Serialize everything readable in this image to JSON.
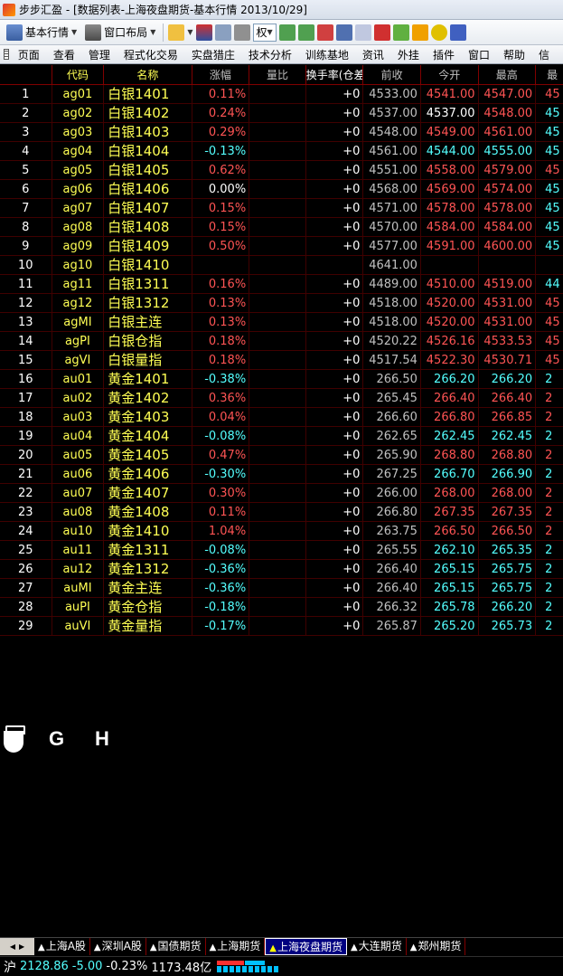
{
  "window": {
    "title": "步步汇盈 - [数据列表-上海夜盘期货-基本行情 2013/10/29]"
  },
  "toolbar": {
    "basic_quote": "基本行情",
    "window_layout": "窗口布局",
    "quan_label": "权"
  },
  "menu": [
    "页面",
    "查看",
    "管理",
    "程式化交易",
    "实盘猎庄",
    "技术分析",
    "训练基地",
    "资讯",
    "外挂",
    "插件",
    "窗口",
    "帮助",
    "信"
  ],
  "columns": {
    "idx": "",
    "code": "代码",
    "name": "名称",
    "chg": "涨幅",
    "ratio": "量比",
    "turnover": "换手率(仓差",
    "prev": "前收",
    "open": "今开",
    "high": "最高",
    "last": "最"
  },
  "rows": [
    {
      "idx": "1",
      "code": "ag01",
      "name": "白银1401",
      "chg": "0.11%",
      "dir": "up",
      "turn": "+0",
      "prev": "4533.00",
      "open": "4541.00",
      "open_dir": "up",
      "high": "4547.00",
      "high_dir": "up",
      "last": "45",
      "last_dir": "up"
    },
    {
      "idx": "2",
      "code": "ag02",
      "name": "白银1402",
      "chg": "0.24%",
      "dir": "up",
      "turn": "+0",
      "prev": "4537.00",
      "open": "4537.00",
      "open_dir": "eq",
      "high": "4548.00",
      "high_dir": "up",
      "last": "45",
      "last_dir": "dn"
    },
    {
      "idx": "3",
      "code": "ag03",
      "name": "白银1403",
      "chg": "0.29%",
      "dir": "up",
      "turn": "+0",
      "prev": "4548.00",
      "open": "4549.00",
      "open_dir": "up",
      "high": "4561.00",
      "high_dir": "up",
      "last": "45",
      "last_dir": "dn"
    },
    {
      "idx": "4",
      "code": "ag04",
      "name": "白银1404",
      "chg": "-0.13%",
      "dir": "dn",
      "turn": "+0",
      "prev": "4561.00",
      "open": "4544.00",
      "open_dir": "dn",
      "high": "4555.00",
      "high_dir": "dn",
      "last": "45",
      "last_dir": "dn"
    },
    {
      "idx": "5",
      "code": "ag05",
      "name": "白银1405",
      "chg": "0.62%",
      "dir": "up",
      "turn": "+0",
      "prev": "4551.00",
      "open": "4558.00",
      "open_dir": "up",
      "high": "4579.00",
      "high_dir": "up",
      "last": "45",
      "last_dir": "up"
    },
    {
      "idx": "6",
      "code": "ag06",
      "name": "白银1406",
      "chg": "0.00%",
      "dir": "eq",
      "turn": "+0",
      "prev": "4568.00",
      "open": "4569.00",
      "open_dir": "up",
      "high": "4574.00",
      "high_dir": "up",
      "last": "45",
      "last_dir": "dn"
    },
    {
      "idx": "7",
      "code": "ag07",
      "name": "白银1407",
      "chg": "0.15%",
      "dir": "up",
      "turn": "+0",
      "prev": "4571.00",
      "open": "4578.00",
      "open_dir": "up",
      "high": "4578.00",
      "high_dir": "up",
      "last": "45",
      "last_dir": "dn"
    },
    {
      "idx": "8",
      "code": "ag08",
      "name": "白银1408",
      "chg": "0.15%",
      "dir": "up",
      "turn": "+0",
      "prev": "4570.00",
      "open": "4584.00",
      "open_dir": "up",
      "high": "4584.00",
      "high_dir": "up",
      "last": "45",
      "last_dir": "dn"
    },
    {
      "idx": "9",
      "code": "ag09",
      "name": "白银1409",
      "chg": "0.50%",
      "dir": "up",
      "turn": "+0",
      "prev": "4577.00",
      "open": "4591.00",
      "open_dir": "up",
      "high": "4600.00",
      "high_dir": "up",
      "last": "45",
      "last_dir": "dn"
    },
    {
      "idx": "10",
      "code": "ag10",
      "name": "白银1410",
      "chg": "",
      "dir": "eq",
      "turn": "",
      "prev": "4641.00",
      "open": "",
      "open_dir": "eq",
      "high": "",
      "high_dir": "eq",
      "last": "",
      "last_dir": "eq"
    },
    {
      "idx": "11",
      "code": "ag11",
      "name": "白银1311",
      "chg": "0.16%",
      "dir": "up",
      "turn": "+0",
      "prev": "4489.00",
      "open": "4510.00",
      "open_dir": "up",
      "high": "4519.00",
      "high_dir": "up",
      "last": "44",
      "last_dir": "dn"
    },
    {
      "idx": "12",
      "code": "ag12",
      "name": "白银1312",
      "chg": "0.13%",
      "dir": "up",
      "turn": "+0",
      "prev": "4518.00",
      "open": "4520.00",
      "open_dir": "up",
      "high": "4531.00",
      "high_dir": "up",
      "last": "45",
      "last_dir": "up"
    },
    {
      "idx": "13",
      "code": "agMI",
      "name": "白银主连",
      "chg": "0.13%",
      "dir": "up",
      "turn": "+0",
      "prev": "4518.00",
      "open": "4520.00",
      "open_dir": "up",
      "high": "4531.00",
      "high_dir": "up",
      "last": "45",
      "last_dir": "up"
    },
    {
      "idx": "14",
      "code": "agPI",
      "name": "白银仓指",
      "chg": "0.18%",
      "dir": "up",
      "turn": "+0",
      "prev": "4520.22",
      "open": "4526.16",
      "open_dir": "up",
      "high": "4533.53",
      "high_dir": "up",
      "last": "45",
      "last_dir": "up"
    },
    {
      "idx": "15",
      "code": "agVI",
      "name": "白银量指",
      "chg": "0.18%",
      "dir": "up",
      "turn": "+0",
      "prev": "4517.54",
      "open": "4522.30",
      "open_dir": "up",
      "high": "4530.71",
      "high_dir": "up",
      "last": "45",
      "last_dir": "up"
    },
    {
      "idx": "16",
      "code": "au01",
      "name": "黄金1401",
      "chg": "-0.38%",
      "dir": "dn",
      "turn": "+0",
      "prev": "266.50",
      "open": "266.20",
      "open_dir": "dn",
      "high": "266.20",
      "high_dir": "dn",
      "last": "2",
      "last_dir": "dn"
    },
    {
      "idx": "17",
      "code": "au02",
      "name": "黄金1402",
      "chg": "0.36%",
      "dir": "up",
      "turn": "+0",
      "prev": "265.45",
      "open": "266.40",
      "open_dir": "up",
      "high": "266.40",
      "high_dir": "up",
      "last": "2",
      "last_dir": "up"
    },
    {
      "idx": "18",
      "code": "au03",
      "name": "黄金1403",
      "chg": "0.04%",
      "dir": "up",
      "turn": "+0",
      "prev": "266.60",
      "open": "266.80",
      "open_dir": "up",
      "high": "266.85",
      "high_dir": "up",
      "last": "2",
      "last_dir": "up"
    },
    {
      "idx": "19",
      "code": "au04",
      "name": "黄金1404",
      "chg": "-0.08%",
      "dir": "dn",
      "turn": "+0",
      "prev": "262.65",
      "open": "262.45",
      "open_dir": "dn",
      "high": "262.45",
      "high_dir": "dn",
      "last": "2",
      "last_dir": "dn"
    },
    {
      "idx": "20",
      "code": "au05",
      "name": "黄金1405",
      "chg": "0.47%",
      "dir": "up",
      "turn": "+0",
      "prev": "265.90",
      "open": "268.80",
      "open_dir": "up",
      "high": "268.80",
      "high_dir": "up",
      "last": "2",
      "last_dir": "up"
    },
    {
      "idx": "21",
      "code": "au06",
      "name": "黄金1406",
      "chg": "-0.30%",
      "dir": "dn",
      "turn": "+0",
      "prev": "267.25",
      "open": "266.70",
      "open_dir": "dn",
      "high": "266.90",
      "high_dir": "dn",
      "last": "2",
      "last_dir": "dn"
    },
    {
      "idx": "22",
      "code": "au07",
      "name": "黄金1407",
      "chg": "0.30%",
      "dir": "up",
      "turn": "+0",
      "prev": "266.00",
      "open": "268.00",
      "open_dir": "up",
      "high": "268.00",
      "high_dir": "up",
      "last": "2",
      "last_dir": "up"
    },
    {
      "idx": "23",
      "code": "au08",
      "name": "黄金1408",
      "chg": "0.11%",
      "dir": "up",
      "turn": "+0",
      "prev": "266.80",
      "open": "267.35",
      "open_dir": "up",
      "high": "267.35",
      "high_dir": "up",
      "last": "2",
      "last_dir": "up"
    },
    {
      "idx": "24",
      "code": "au10",
      "name": "黄金1410",
      "chg": "1.04%",
      "dir": "up",
      "turn": "+0",
      "prev": "263.75",
      "open": "266.50",
      "open_dir": "up",
      "high": "266.50",
      "high_dir": "up",
      "last": "2",
      "last_dir": "up"
    },
    {
      "idx": "25",
      "code": "au11",
      "name": "黄金1311",
      "chg": "-0.08%",
      "dir": "dn",
      "turn": "+0",
      "prev": "265.55",
      "open": "262.10",
      "open_dir": "dn",
      "high": "265.35",
      "high_dir": "dn",
      "last": "2",
      "last_dir": "dn"
    },
    {
      "idx": "26",
      "code": "au12",
      "name": "黄金1312",
      "chg": "-0.36%",
      "dir": "dn",
      "turn": "+0",
      "prev": "266.40",
      "open": "265.15",
      "open_dir": "dn",
      "high": "265.75",
      "high_dir": "dn",
      "last": "2",
      "last_dir": "dn"
    },
    {
      "idx": "27",
      "code": "auMI",
      "name": "黄金主连",
      "chg": "-0.36%",
      "dir": "dn",
      "turn": "+0",
      "prev": "266.40",
      "open": "265.15",
      "open_dir": "dn",
      "high": "265.75",
      "high_dir": "dn",
      "last": "2",
      "last_dir": "dn"
    },
    {
      "idx": "28",
      "code": "auPI",
      "name": "黄金仓指",
      "chg": "-0.18%",
      "dir": "dn",
      "turn": "+0",
      "prev": "266.32",
      "open": "265.78",
      "open_dir": "dn",
      "high": "266.20",
      "high_dir": "dn",
      "last": "2",
      "last_dir": "dn"
    },
    {
      "idx": "29",
      "code": "auVI",
      "name": "黄金量指",
      "chg": "-0.17%",
      "dir": "dn",
      "turn": "+0",
      "prev": "265.87",
      "open": "265.20",
      "open_dir": "dn",
      "high": "265.73",
      "high_dir": "dn",
      "last": "2",
      "last_dir": "dn"
    }
  ],
  "overlay": {
    "g": "G",
    "h": "H"
  },
  "tabs": [
    {
      "label": "上海A股",
      "active": false
    },
    {
      "label": "深圳A股",
      "active": false
    },
    {
      "label": "国债期货",
      "active": false
    },
    {
      "label": "上海期货",
      "active": false
    },
    {
      "label": "上海夜盘期货",
      "active": true
    },
    {
      "label": "大连期货",
      "active": false
    },
    {
      "label": "郑州期货",
      "active": false
    }
  ],
  "status": {
    "market": "沪",
    "index": "2128.86",
    "change": "-5.00",
    "pct": "-0.23%",
    "amount": "1173.48亿"
  },
  "colors": {
    "up": "#ff5454",
    "down": "#54ffff",
    "flat": "#ffffff",
    "code": "#ffff54",
    "grid": "#800000"
  }
}
